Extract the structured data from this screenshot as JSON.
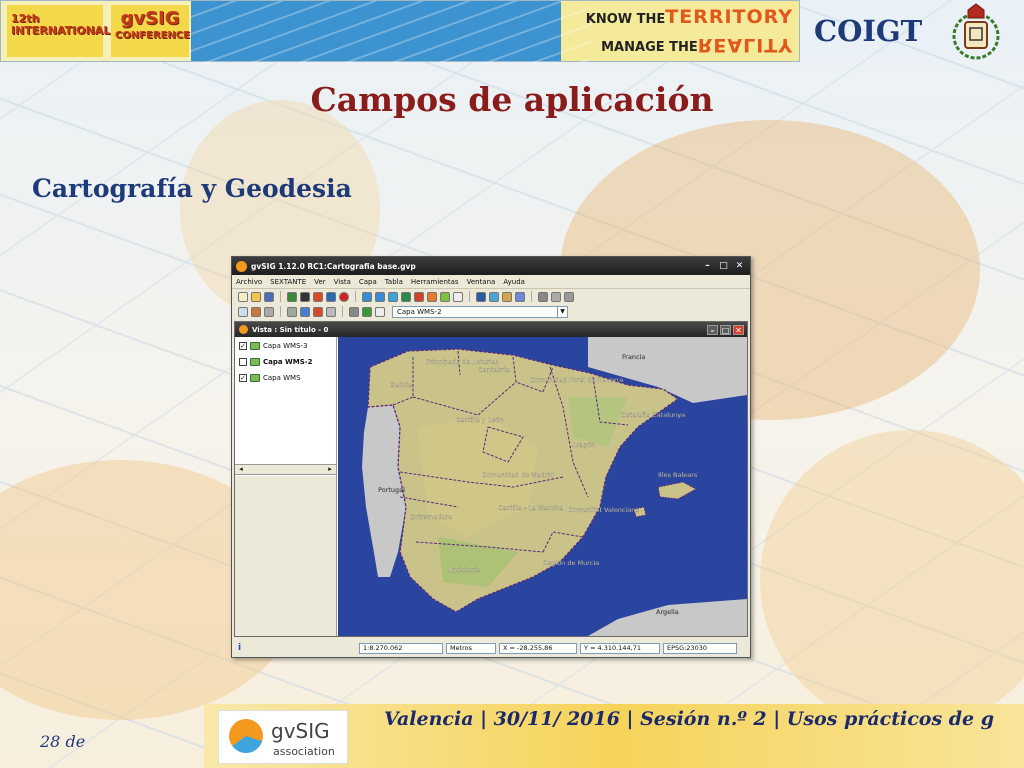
{
  "banner": {
    "conf_line1": "12th",
    "conf_line2": "INTERNATIONAL",
    "gvsig": "gvSIG",
    "gvsig_sub": "CONFERENCE",
    "tag1_a": "KNOW THE",
    "tag1_b": "TERRITORY",
    "tag2_a": "MANAGE THE",
    "tag2_b": "REALITY"
  },
  "org": "COIGT",
  "title": "Campos de aplicación",
  "subtitle": "Cartografía y Geodesia",
  "app": {
    "window_title": "gvSIG 1.12.0 RC1:Cartografia base.gvp",
    "menu": [
      "Archivo",
      "SEXTANTE",
      "Ver",
      "Vista",
      "Capa",
      "Tabla",
      "Herramientas",
      "Ventana",
      "Ayuda"
    ],
    "layer_select": "Capa WMS-2",
    "view_title": "Vista : Sin título - 0",
    "layers": [
      {
        "name": "Capa WMS-3",
        "checked": true
      },
      {
        "name": "Capa WMS-2",
        "checked": false
      },
      {
        "name": "Capa WMS",
        "checked": true
      }
    ],
    "map_labels": {
      "francia": "Francia",
      "portugal": "Portugal",
      "argelia": "Argelia",
      "galicia": "Galicia",
      "asturias": "Principado de Asturias",
      "cantabria": "Cantabria",
      "navarra": "Comunidad Foral de Navarra",
      "cataluna": "Cataluña Catalunya",
      "aragon": "Aragón",
      "castilla_leon": "Castilla y León",
      "madrid": "Comunidad de Madrid",
      "castilla_mancha": "Castilla - La Mancha",
      "valenciana": "Comunitat Valenciana",
      "extremadura": "Extremadura",
      "baleares": "Illes Balears",
      "andalucia": "Andalucía",
      "murcia": "Región de Murcia"
    },
    "status": {
      "scale": "1:8.270.062",
      "units": "Metros",
      "x": "X = -28.255,86",
      "y": "Y = 4.310.144,71",
      "epsg": "EPSG:23030"
    },
    "colors": {
      "sea": "#2a45a0",
      "land_out": "#c8c8c8",
      "spain": "#c9c38a",
      "border": "#5a2a7a"
    }
  },
  "footer": {
    "logo_text": "gvSIG",
    "logo_sub": "association",
    "text": "Valencia | 30/11/ 2016 | Sesión n.º 2 | Usos prácticos de g",
    "page": "28 de"
  }
}
